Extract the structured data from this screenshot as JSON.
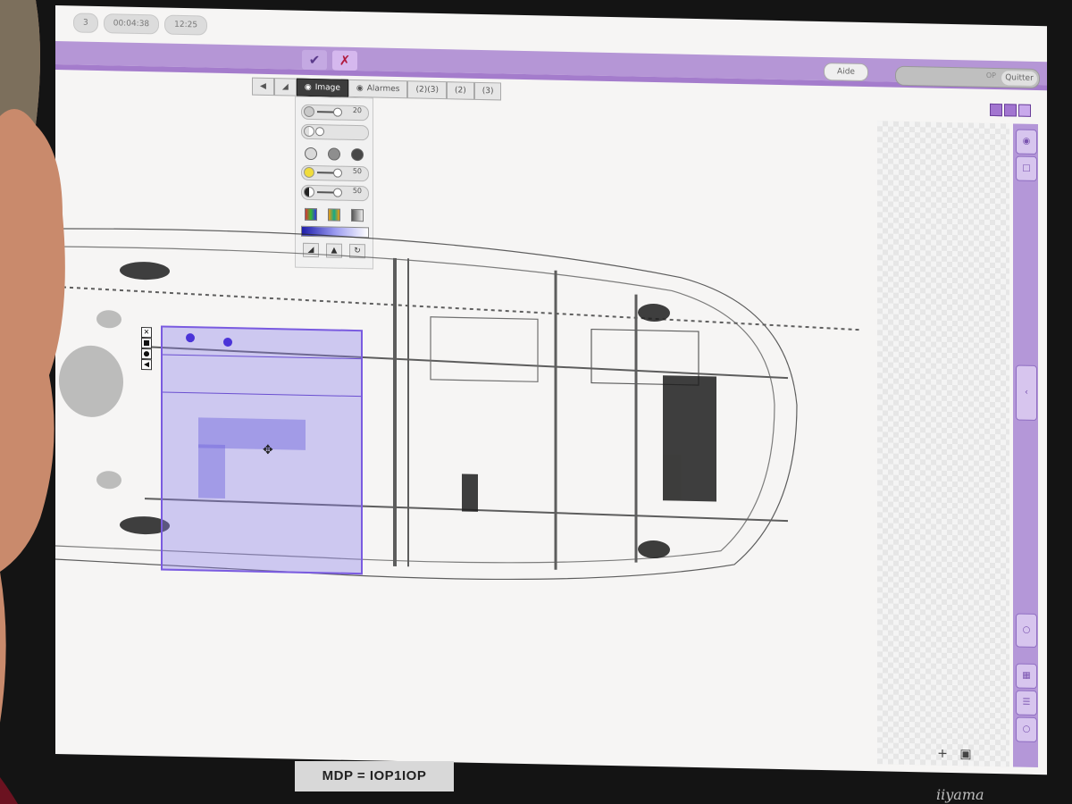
{
  "status_bar": {
    "counter": "3",
    "elapsed": "00:04:38",
    "clock": "12:25"
  },
  "header": {
    "accept_icon": "check-icon",
    "reject_icon": "cross-icon",
    "help_label": "Aide",
    "quit_label": "Quitter",
    "quit_hint": "OP"
  },
  "toolbar": {
    "tabs": [
      {
        "label": "Image",
        "icon": "image-icon",
        "active": true
      },
      {
        "label": "Alarmes",
        "icon": "alarm-icon",
        "active": false
      },
      {
        "label": "(2)(3)",
        "icon": "",
        "active": false
      },
      {
        "label": "(2)",
        "icon": "",
        "active": false
      },
      {
        "label": "(3)",
        "icon": "",
        "active": false
      }
    ]
  },
  "image_panel": {
    "zoom_value": "20",
    "brightness_value": "50",
    "contrast_value": "50"
  },
  "colors": {
    "accent_purple": "#b596d6",
    "selection_fill": "#8c7deb",
    "reject_red": "#b01a3d",
    "accept_purple": "#5a3a8a"
  },
  "footer": {
    "password_label": "MDP = IOP1IOP",
    "brand": "iiyama"
  }
}
